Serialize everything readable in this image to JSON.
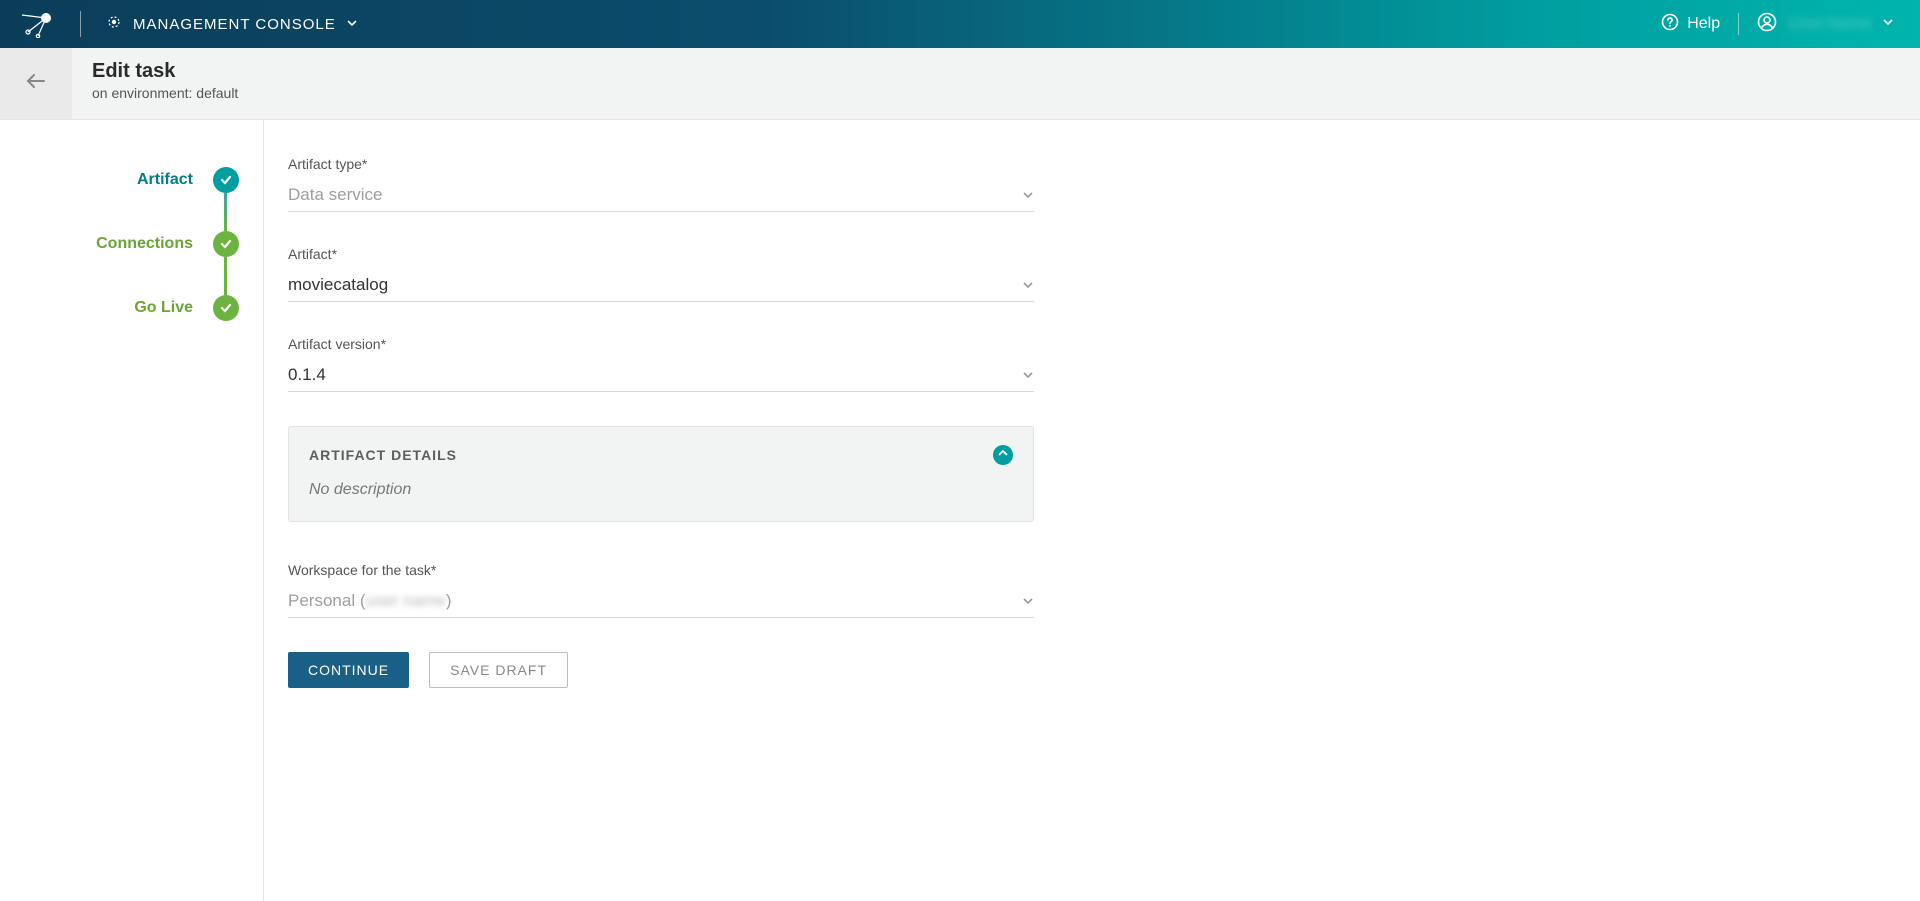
{
  "header": {
    "console_label": "MANAGEMENT CONSOLE",
    "help_label": "Help",
    "user_name": "User Name"
  },
  "subheader": {
    "title": "Edit task",
    "subtitle": "on environment: default"
  },
  "stepper": {
    "steps": [
      {
        "label": "Artifact",
        "state": "current"
      },
      {
        "label": "Connections",
        "state": "done"
      },
      {
        "label": "Go Live",
        "state": "done"
      }
    ]
  },
  "form": {
    "artifact_type": {
      "label": "Artifact type*",
      "value": "Data service",
      "disabled": true
    },
    "artifact": {
      "label": "Artifact*",
      "value": "moviecatalog",
      "disabled": false
    },
    "artifact_version": {
      "label": "Artifact version*",
      "value": "0.1.4",
      "disabled": false
    },
    "details_panel": {
      "title": "ARTIFACT DETAILS",
      "body": "No description"
    },
    "workspace": {
      "label": "Workspace for the task*",
      "prefix": "Personal (",
      "blurred": "user name",
      "suffix": ")",
      "disabled": true
    },
    "actions": {
      "continue": "CONTINUE",
      "save_draft": "SAVE DRAFT"
    }
  }
}
